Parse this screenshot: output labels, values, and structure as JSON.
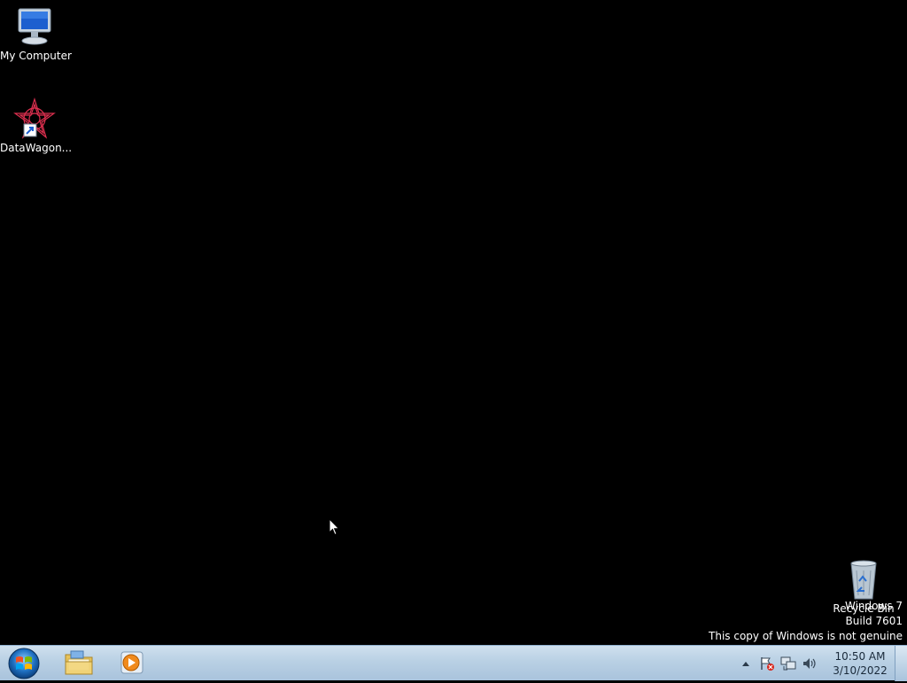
{
  "desktop": {
    "icons": [
      {
        "label": "My Computer",
        "icon": "computer-icon"
      },
      {
        "label": "DataWagon...",
        "icon": "datawagon-shortcut-icon"
      },
      {
        "label": "Recycle Bin",
        "icon": "recycle-bin-icon"
      }
    ],
    "watermark": {
      "line1": "Windows 7",
      "line2": "Build 7601",
      "line3": "This copy of Windows is not genuine"
    }
  },
  "taskbar": {
    "start_icon": "windows-start-orb-icon",
    "pinned": [
      {
        "icon": "folder-explorer-icon"
      },
      {
        "icon": "media-player-icon"
      }
    ],
    "tray": {
      "icons": [
        "show-hidden-icons-icon",
        "action-center-flag-icon",
        "network-icon",
        "volume-icon"
      ],
      "time": "10:50 AM",
      "date": "3/10/2022"
    }
  },
  "colors": {
    "desktop_bg": "#000000",
    "taskbar_top": "#cfe0ee",
    "taskbar_bottom": "#a9c3dc"
  }
}
